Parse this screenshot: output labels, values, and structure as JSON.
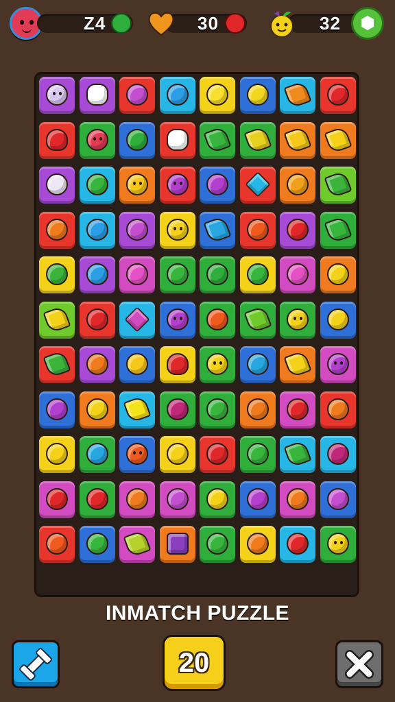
{
  "hud": {
    "moves_value": "Z4",
    "lives_value": "30",
    "score_value": "32"
  },
  "title": "INMATCH PUZZLE",
  "buttons": {
    "level_value": "20"
  },
  "palette": {
    "purple": "#a74bd6",
    "red": "#e8362d",
    "orange": "#f07a1e",
    "yellow": "#f4d21a",
    "green": "#2fae3c",
    "lime": "#6ecb2b",
    "blue": "#2e6fd8",
    "cyan": "#27b7e6",
    "magenta": "#d24bc0"
  },
  "grid": [
    [
      [
        "purple",
        "#d9c7f3",
        "face"
      ],
      [
        "purple",
        "#ffffff",
        "star"
      ],
      [
        "red",
        "#c34fd0",
        "fruit"
      ],
      [
        "cyan",
        "#2c9ee6",
        "fruit"
      ],
      [
        "yellow",
        "#f7df2b",
        "fruit"
      ],
      [
        "blue",
        "#f1d81e",
        "fruit"
      ],
      [
        "cyan",
        "#f08a1e",
        "leaf"
      ],
      [
        "red",
        "#e0282a",
        "fruit"
      ]
    ],
    [
      [
        "red",
        "#e0282a",
        "heart"
      ],
      [
        "green",
        "#e23b55",
        "face"
      ],
      [
        "blue",
        "#2fae3c",
        "fruit"
      ],
      [
        "red",
        "#ffffff",
        "star"
      ],
      [
        "green",
        "#37b53c",
        "leaf"
      ],
      [
        "green",
        "#e6d11e",
        "leaf"
      ],
      [
        "orange",
        "#f4c91c",
        "leaf"
      ],
      [
        "orange",
        "#f4d21a",
        "leaf"
      ]
    ],
    [
      [
        "purple",
        "#ece7f2",
        "fruit"
      ],
      [
        "cyan",
        "#37b53c",
        "fruit"
      ],
      [
        "orange",
        "#f7c71a",
        "face"
      ],
      [
        "red",
        "#b33fce",
        "face"
      ],
      [
        "blue",
        "#b33fce",
        "fruit"
      ],
      [
        "red",
        "#27b7e6",
        "diamond"
      ],
      [
        "orange",
        "#f0a01a",
        "fruit"
      ],
      [
        "lime",
        "#3cb43c",
        "leaf"
      ]
    ],
    [
      [
        "red",
        "#f07a1e",
        "fruit"
      ],
      [
        "cyan",
        "#2c9ee6",
        "fruit"
      ],
      [
        "purple",
        "#c34fd0",
        "fruit"
      ],
      [
        "yellow",
        "#f4d21a",
        "face"
      ],
      [
        "blue",
        "#27a6e0",
        "leaf"
      ],
      [
        "red",
        "#f05a1e",
        "fruit"
      ],
      [
        "purple",
        "#e0282a",
        "fruit"
      ],
      [
        "green",
        "#37b53c",
        "leaf"
      ]
    ],
    [
      [
        "yellow",
        "#3cb43c",
        "fruit"
      ],
      [
        "purple",
        "#2c9ee6",
        "fruit"
      ],
      [
        "magenta",
        "#e451c4",
        "fruit"
      ],
      [
        "green",
        "#37b53c",
        "fruit"
      ],
      [
        "green",
        "#2fae3c",
        "fruit"
      ],
      [
        "yellow",
        "#37b53c",
        "fruit"
      ],
      [
        "magenta",
        "#e451c4",
        "fruit"
      ],
      [
        "orange",
        "#f4d21a",
        "fruit"
      ]
    ],
    [
      [
        "lime",
        "#f4d21a",
        "leaf"
      ],
      [
        "red",
        "#e0282a",
        "fruit"
      ],
      [
        "cyan",
        "#d24bc0",
        "diamond"
      ],
      [
        "blue",
        "#b33fce",
        "face"
      ],
      [
        "green",
        "#f05a1e",
        "fruit"
      ],
      [
        "green",
        "#6ecb2b",
        "leaf"
      ],
      [
        "green",
        "#f4d21a",
        "face"
      ],
      [
        "blue",
        "#f4d21a",
        "fruit"
      ]
    ],
    [
      [
        "red",
        "#3cb43c",
        "leaf"
      ],
      [
        "purple",
        "#f07a1e",
        "fruit"
      ],
      [
        "blue",
        "#f4c91c",
        "fruit"
      ],
      [
        "yellow",
        "#e0282a",
        "heart"
      ],
      [
        "green",
        "#f4d21a",
        "face"
      ],
      [
        "blue",
        "#27a6e0",
        "fruit"
      ],
      [
        "orange",
        "#f4d21a",
        "leaf"
      ],
      [
        "magenta",
        "#b33fce",
        "face"
      ]
    ],
    [
      [
        "blue",
        "#b33fce",
        "fruit"
      ],
      [
        "orange",
        "#f4d21a",
        "fruit"
      ],
      [
        "cyan",
        "#f4e21a",
        "leaf"
      ],
      [
        "green",
        "#c0287a",
        "fruit"
      ],
      [
        "green",
        "#37b53c",
        "fruit"
      ],
      [
        "orange",
        "#f07a1e",
        "fruit"
      ],
      [
        "magenta",
        "#e0282a",
        "fruit"
      ],
      [
        "red",
        "#f07a1e",
        "fruit"
      ]
    ],
    [
      [
        "yellow",
        "#f4d21a",
        "fruit"
      ],
      [
        "green",
        "#27a6e0",
        "fruit"
      ],
      [
        "blue",
        "#f05a1e",
        "face"
      ],
      [
        "yellow",
        "#f4d21a",
        "fruit"
      ],
      [
        "red",
        "#e0282a",
        "fruit"
      ],
      [
        "green",
        "#37b53c",
        "fruit"
      ],
      [
        "cyan",
        "#37b53c",
        "leaf"
      ],
      [
        "cyan",
        "#c0287a",
        "fruit"
      ]
    ],
    [
      [
        "magenta",
        "#e0282a",
        "fruit"
      ],
      [
        "green",
        "#e0282a",
        "fruit"
      ],
      [
        "magenta",
        "#f07a1e",
        "fruit"
      ],
      [
        "magenta",
        "#c34fd0",
        "fruit"
      ],
      [
        "green",
        "#f4d21a",
        "fruit"
      ],
      [
        "blue",
        "#b33fce",
        "fruit"
      ],
      [
        "magenta",
        "#f07a1e",
        "fruit"
      ],
      [
        "blue",
        "#c34fd0",
        "fruit"
      ]
    ],
    [
      [
        "red",
        "#f05a1e",
        "fruit"
      ],
      [
        "blue",
        "#37b53c",
        "fruit"
      ],
      [
        "magenta",
        "#b6d12b",
        "leaf"
      ],
      [
        "orange",
        "#8a3fbf",
        "dice"
      ],
      [
        "green",
        "#37b53c",
        "fruit"
      ],
      [
        "yellow",
        "#f07a1e",
        "fruit"
      ],
      [
        "cyan",
        "#e0282a",
        "fruit"
      ],
      [
        "green",
        "#f4d21a",
        "face"
      ]
    ]
  ]
}
